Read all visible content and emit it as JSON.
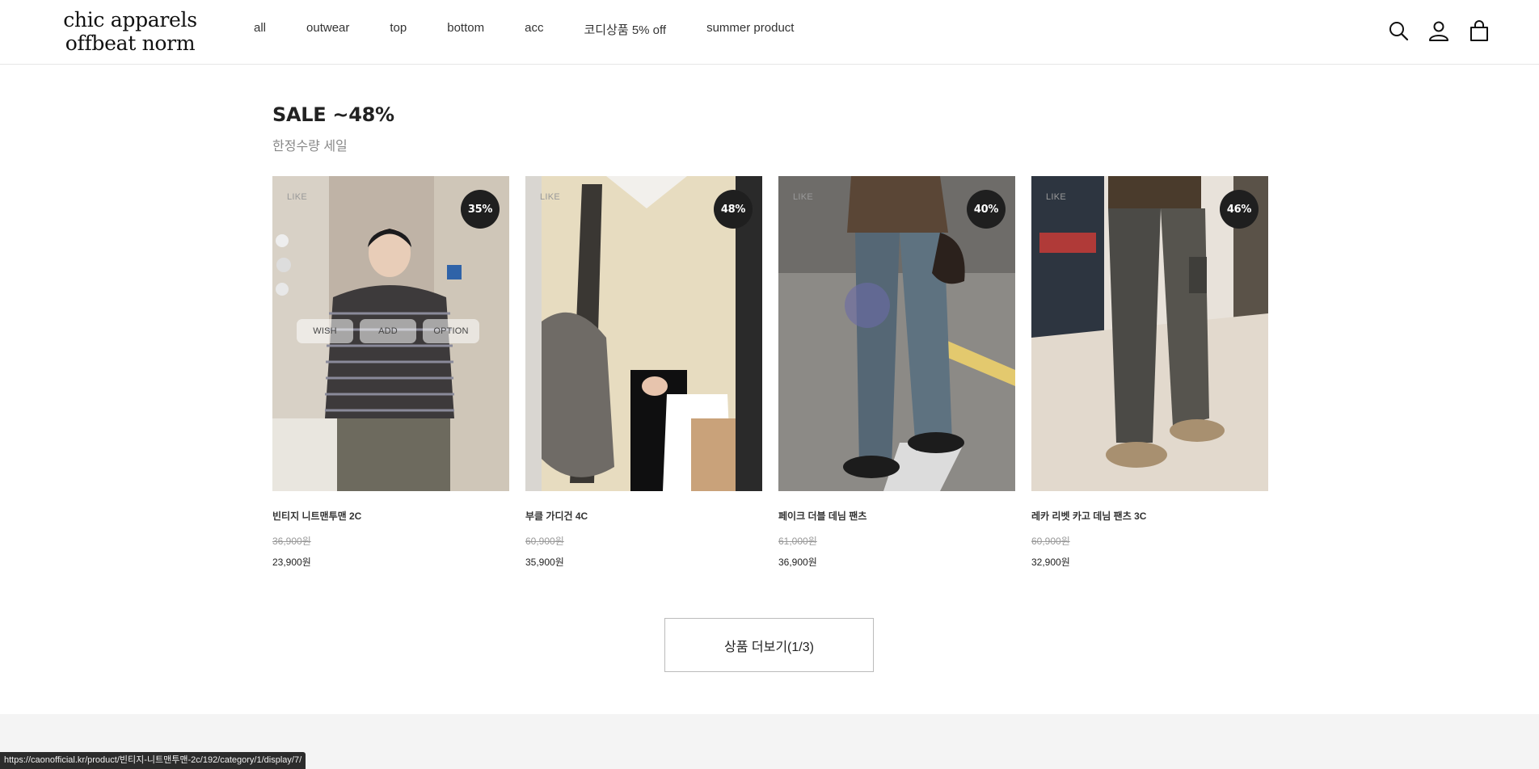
{
  "brand": {
    "line1": "chic apparels",
    "line2": "offbeat norm"
  },
  "nav": [
    "all",
    "outwear",
    "top",
    "bottom",
    "acc",
    "코디상품 5% off",
    "summer product"
  ],
  "header_icons": [
    "search-icon",
    "user-icon",
    "cart-icon"
  ],
  "section": {
    "title": "SALE ~48%",
    "subtitle": "한정수량 세일"
  },
  "hover_buttons": {
    "wish": "WISH",
    "add": "ADD",
    "option": "OPTION"
  },
  "like_label": "LIKE",
  "products": [
    {
      "name": "빈티지 니트맨투맨 2C",
      "original_price": "36,900원",
      "sale_price": "23,900원",
      "discount": "35%"
    },
    {
      "name": "부클 가디건 4C",
      "original_price": "60,900원",
      "sale_price": "35,900원",
      "discount": "48%"
    },
    {
      "name": "페이크 더블 데님 팬츠",
      "original_price": "61,000원",
      "sale_price": "36,900원",
      "discount": "40%"
    },
    {
      "name": "레카 리벳 카고 데님 팬츠 3C",
      "original_price": "60,900원",
      "sale_price": "32,900원",
      "discount": "46%"
    }
  ],
  "more_button": "상품 더보기(1/3)",
  "status_url": "https://caonofficial.kr/product/빈티지-니트맨투맨-2c/192/category/1/display/7/"
}
